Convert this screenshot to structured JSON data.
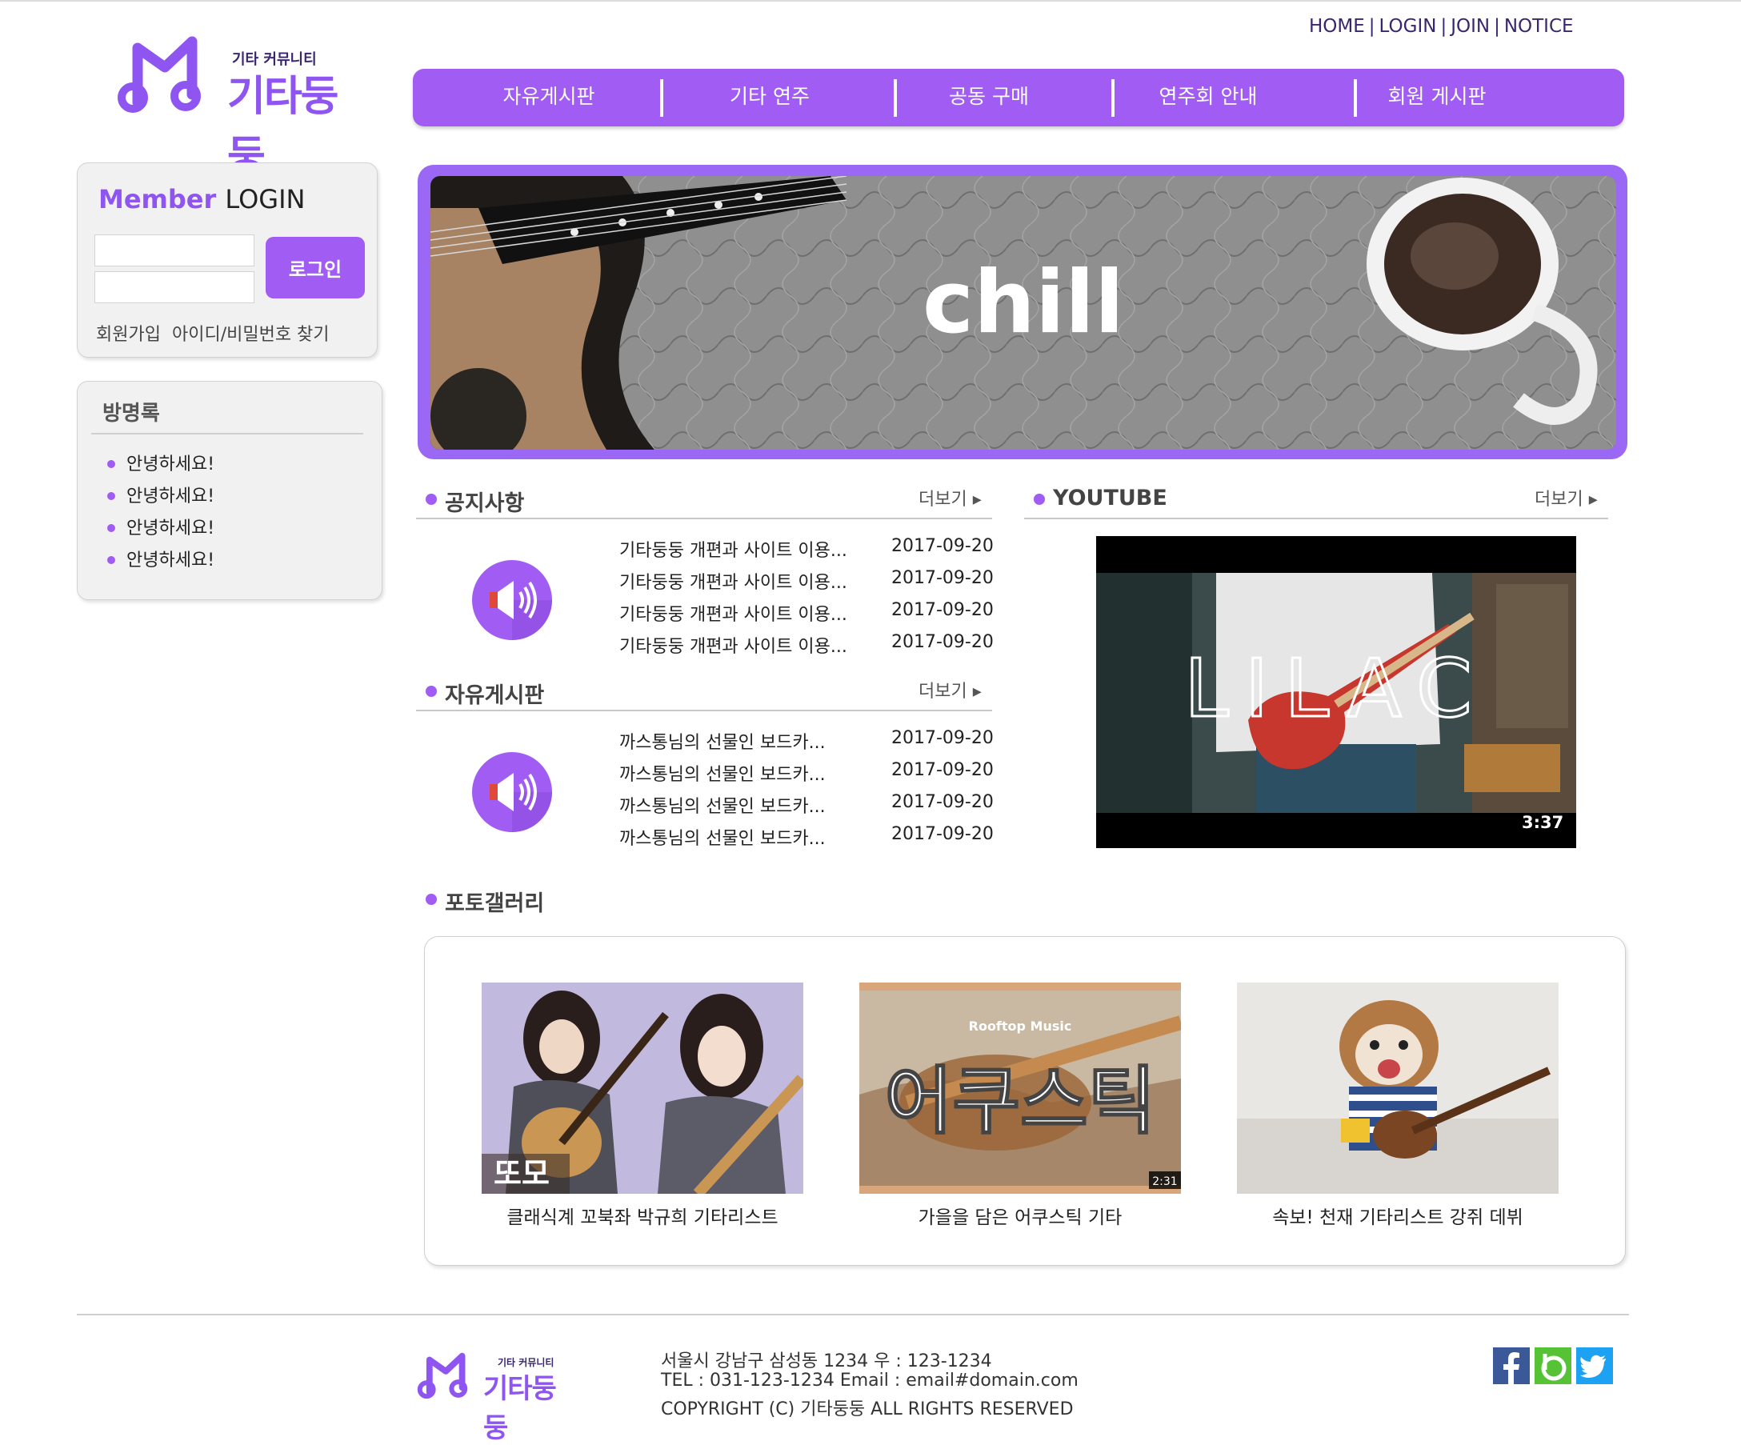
{
  "top_links": [
    "HOME",
    "LOGIN",
    "JOIN",
    "NOTICE"
  ],
  "top_link_separator": "|",
  "logo": {
    "tagline": "기타 커뮤니티",
    "name": "기타둥둥"
  },
  "nav": [
    "자유게시판",
    "기타 연주",
    "공동 구매",
    "연주회 안내",
    "회원 게시판"
  ],
  "login": {
    "title_accent": "Member",
    "title_rest": "LOGIN",
    "button": "로그인",
    "links": [
      "회원가입",
      "아이디/비밀번호 찾기"
    ]
  },
  "guestbook": {
    "title": "방명록",
    "items": [
      "안녕하세요!",
      "안녕하세요!",
      "안녕하세요!",
      "안녕하세요!"
    ]
  },
  "banner": {
    "text": "chill"
  },
  "notice": {
    "title": "공지사항",
    "more": "더보기 ▸",
    "posts": [
      {
        "title": "기타둥둥 개편과 사이트 이용...",
        "date": "2017-09-20"
      },
      {
        "title": "기타둥둥 개편과 사이트 이용...",
        "date": "2017-09-20"
      },
      {
        "title": "기타둥둥 개편과 사이트 이용...",
        "date": "2017-09-20"
      },
      {
        "title": "기타둥둥 개편과 사이트 이용...",
        "date": "2017-09-20"
      }
    ]
  },
  "free_board": {
    "title": "자유게시판",
    "more": "더보기 ▸",
    "posts": [
      {
        "title": "까스통님의 선물인 보드카...",
        "date": "2017-09-20"
      },
      {
        "title": "까스통님의 선물인 보드카...",
        "date": "2017-09-20"
      },
      {
        "title": "까스통님의 선물인 보드카...",
        "date": "2017-09-20"
      },
      {
        "title": "까스통님의 선물인 보드카...",
        "date": "2017-09-20"
      }
    ]
  },
  "youtube": {
    "title": "YOUTUBE",
    "more": "더보기 ▸",
    "video_text": "LILAC",
    "duration": "3:37"
  },
  "gallery": {
    "title": "포토갤러리",
    "items": [
      {
        "caption": "클래식계 꼬북좌 박규희 기타리스트",
        "overlay": "또모"
      },
      {
        "caption": "가을을 담은 어쿠스틱 기타",
        "overlay": "어쿠스틱",
        "overlay_small": "Rooftop Music",
        "duration": "2:31"
      },
      {
        "caption": "속보! 천재 기타리스트 강쥐 데뷔"
      }
    ]
  },
  "footer": {
    "address": "서울시 강남구 삼성동 1234 우 : 123-1234",
    "contact": "TEL : 031-123-1234 Email : email#domain.com",
    "copyright": "COPYRIGHT (C) 기타둥둥 ALL RIGHTS RESERVED"
  },
  "social": [
    "facebook-icon",
    "band-icon",
    "twitter-icon"
  ],
  "colors": {
    "accent": "#a05cf3",
    "dark_purple": "#3a2570",
    "logo_purple": "#8f55f0"
  }
}
